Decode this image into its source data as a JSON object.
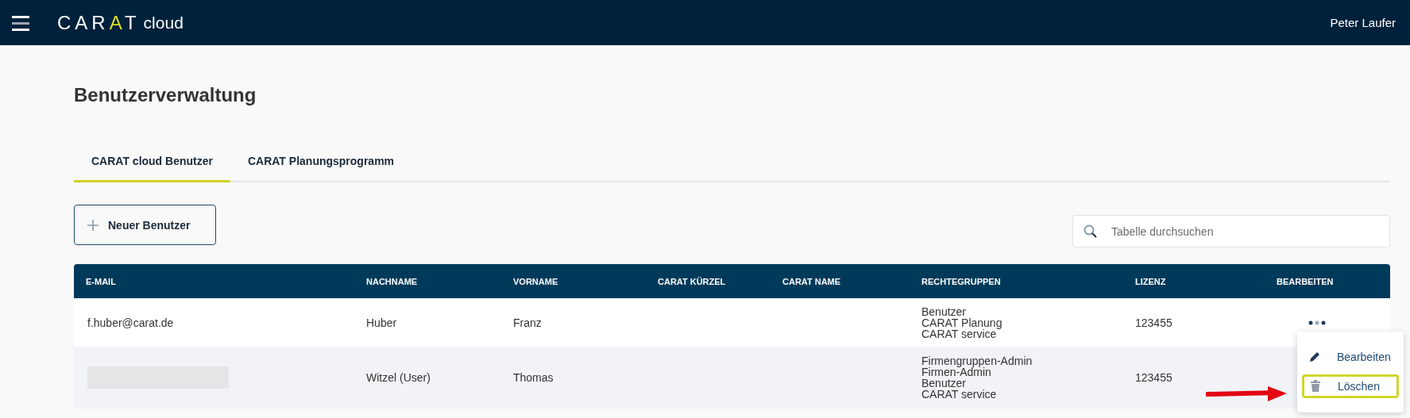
{
  "header": {
    "logo": "CARAT",
    "logo_suffix": "cloud",
    "user": "Peter Laufer"
  },
  "page_title": "Benutzerverwaltung",
  "tabs": [
    {
      "label": "CARAT cloud Benutzer",
      "selected": true
    },
    {
      "label": "CARAT Planungsprogramm",
      "selected": false
    }
  ],
  "new_button": {
    "label": "Neuer Benutzer"
  },
  "search": {
    "placeholder": "Tabelle durchsuchen"
  },
  "table": {
    "columns": [
      "E-MAIL",
      "NACHNAME",
      "VORNAME",
      "CARAT KÜRZEL",
      "CARAT NAME",
      "RECHTEGRUPPEN",
      "LIZENZ",
      "BEARBEITEN"
    ],
    "rows": [
      {
        "email": "f.huber@carat.de",
        "email_redacted": false,
        "nachname": "Huber",
        "vorname": "Franz",
        "rechtegruppen": [
          "Benutzer",
          "CARAT Planung",
          "CARAT service"
        ],
        "lizenz": "123455",
        "actions_visible": true
      },
      {
        "email_redacted": true,
        "nachname": "Witzel (User)",
        "vorname": "Thomas",
        "rechtegruppen": [
          "Firmengruppen-Admin",
          "Firmen-Admin",
          "Benutzer",
          "CARAT service"
        ],
        "lizenz": "123455",
        "actions_visible": false
      }
    ]
  },
  "actions_menu": {
    "items": [
      {
        "kind": "edit",
        "label": "Bearbeiten",
        "highlighted": false
      },
      {
        "kind": "delete",
        "label": "Löschen",
        "highlighted": true
      }
    ]
  }
}
